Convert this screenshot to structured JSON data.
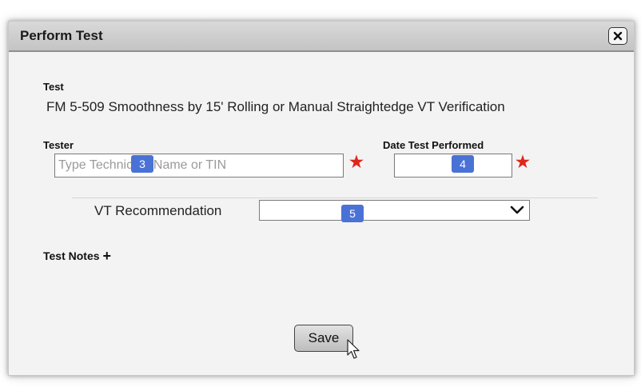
{
  "dialog": {
    "title": "Perform Test",
    "close_icon": "close-icon"
  },
  "test": {
    "label": "Test",
    "name": "FM 5-509 Smoothness by 15' Rolling or Manual Straightedge VT Verification"
  },
  "tester": {
    "label": "Tester",
    "placeholder": "Type Technician Name or TIN",
    "value": "",
    "required_marker": "★",
    "badge": "3"
  },
  "date_performed": {
    "label": "Date Test Performed",
    "value": "",
    "required_marker": "★",
    "badge": "4"
  },
  "vt_recommendation": {
    "label": "VT Recommendation",
    "selected": "",
    "badge": "5"
  },
  "test_notes": {
    "label": "Test Notes",
    "add_icon": "plus-icon"
  },
  "actions": {
    "save_label": "Save"
  },
  "colors": {
    "required": "#e0261b",
    "badge": "#4a72d6",
    "titlebar": "#c9c9c9"
  }
}
